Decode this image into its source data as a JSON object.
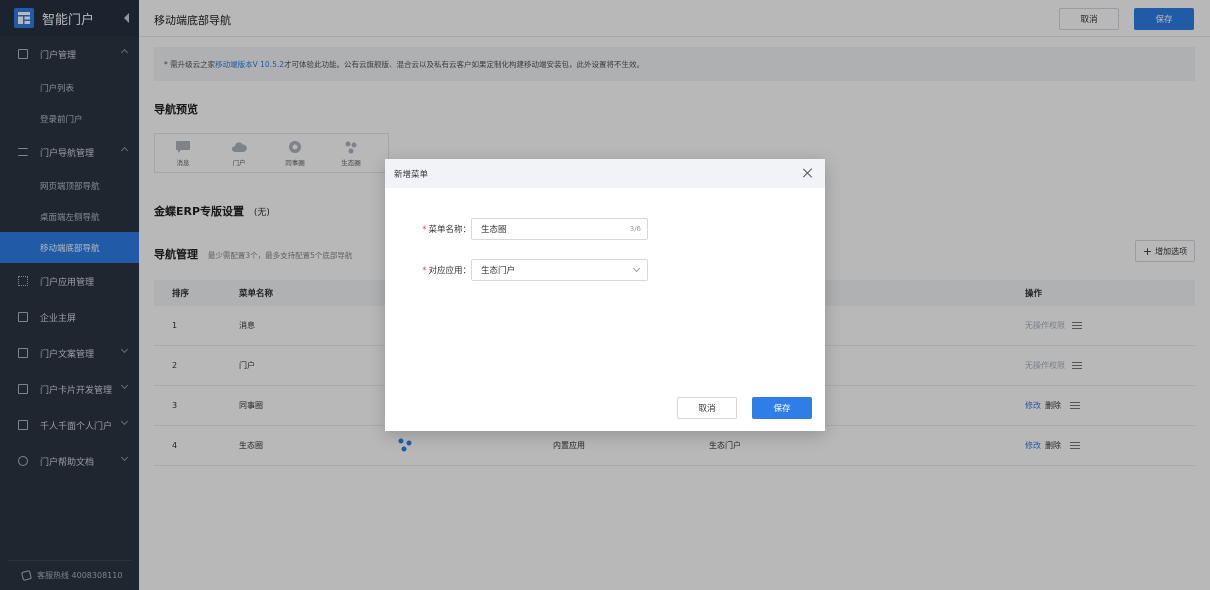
{
  "sidebar": {
    "brand": "智能门户",
    "groups": [
      {
        "label": "门户管理"
      },
      {
        "label": "门户导航管理"
      },
      {
        "label": "门户应用管理"
      },
      {
        "label": "企业主屏"
      },
      {
        "label": "门户文案管理"
      },
      {
        "label": "门户卡片开发管理"
      },
      {
        "label": "千人千面个人门户"
      },
      {
        "label": "门户帮助文档"
      }
    ],
    "subs": [
      "门户列表",
      "登录前门户",
      "网页端顶部导航",
      "桌面端左侧导航",
      "移动端底部导航"
    ],
    "footer": "客服热线 4008308110"
  },
  "header": {
    "title": "移动端底部导航",
    "cancel": "取消",
    "save": "保存"
  },
  "notice": {
    "prefix": "* 需升级云之家",
    "link": "移动端版本V 10.5.2",
    "suffix": "才可体验此功能。公有云旗舰版、混合云以及私有云客户如果定制化构建移动端安装包，此外设置将不生效。"
  },
  "preview": {
    "title": "导航预览",
    "items": [
      "消息",
      "门户",
      "同事圈",
      "生态圈"
    ]
  },
  "erp": {
    "title": "金蝶ERP专版设置",
    "note": "(无)"
  },
  "nav_mgmt": {
    "title": "导航管理",
    "subtitle": "最少需配置3个，最多支持配置5个底部导航",
    "add": "增加选项"
  },
  "table": {
    "headers": {
      "order": "排序",
      "name": "菜单名称",
      "action": "操作"
    },
    "rows": [
      {
        "order": "1",
        "name": "消息",
        "type": "",
        "app": "",
        "action1": "无操作权限",
        "action2": ""
      },
      {
        "order": "2",
        "name": "门户",
        "type": "",
        "app": "",
        "action1": "无操作权限",
        "action2": ""
      },
      {
        "order": "3",
        "name": "同事圈",
        "type": "",
        "app": "",
        "action1": "修改",
        "action2": "删除"
      },
      {
        "order": "4",
        "name": "生态圈",
        "type": "内置应用",
        "app": "生态门户",
        "action1": "修改",
        "action2": "删除"
      }
    ]
  },
  "modal": {
    "title": "新增菜单",
    "name_label": "菜单名称：",
    "name_value": "生态圈",
    "name_count": "3/6",
    "app_label": "对应应用：",
    "app_value": "生态门户",
    "cancel": "取消",
    "save": "保存"
  },
  "colors": {
    "accent": "#2f7ee8",
    "sidebar": "#2c3542",
    "required": "#e64340"
  }
}
